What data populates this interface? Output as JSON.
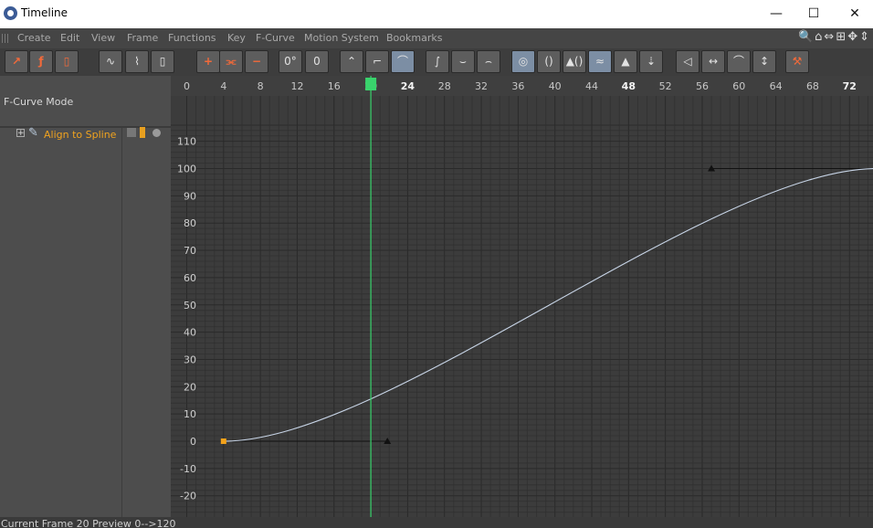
{
  "window": {
    "title": "Timeline"
  },
  "window_controls": {
    "minimize": "—",
    "maximize": "☐",
    "close": "✕"
  },
  "menu": [
    "Create",
    "Edit",
    "View",
    "Frame",
    "Functions",
    "Key",
    "F-Curve",
    "Motion System",
    "Bookmarks"
  ],
  "nav_icons": "🔍⌂⇔⊞✥⇕",
  "toolbar": {
    "buttons": [
      {
        "name": "dope-sheet-mode-button",
        "glyph": "↗",
        "accent": true
      },
      {
        "name": "fcurve-mode-button",
        "glyph": "ƒ",
        "accent": true
      },
      {
        "name": "motion-mode-button",
        "glyph": "▯",
        "accent": true
      },
      {
        "name": "zoom-curves-button",
        "glyph": "∿"
      },
      {
        "name": "frame-all-button",
        "glyph": "⌇"
      },
      {
        "name": "frame-selected-button",
        "glyph": "▯"
      },
      {
        "name": "add-key-button",
        "glyph": "+",
        "accent": true
      },
      {
        "name": "add-keys-button",
        "glyph": "⫘",
        "accent": true
      },
      {
        "name": "delete-key-button",
        "glyph": "−",
        "accent": true
      },
      {
        "name": "rotate-handles-button",
        "glyph": "0°"
      },
      {
        "name": "zero-length-button",
        "glyph": "0"
      },
      {
        "name": "interpolation-linear-button",
        "glyph": "⌃"
      },
      {
        "name": "interpolation-step-button",
        "glyph": "⌐"
      },
      {
        "name": "interpolation-spline-button",
        "glyph": "⌒",
        "selected": true
      },
      {
        "name": "ease-ease-button",
        "glyph": "∫"
      },
      {
        "name": "ease-in-button",
        "glyph": "⌣"
      },
      {
        "name": "ease-out-button",
        "glyph": "⌢"
      },
      {
        "name": "auto-tangents-button",
        "glyph": "◎",
        "selected": true
      },
      {
        "name": "clamp-button",
        "glyph": "()"
      },
      {
        "name": "clamp-zero-button",
        "glyph": "▲()"
      },
      {
        "name": "overshoot-button",
        "glyph": "≈",
        "selected": true
      },
      {
        "name": "weighted-tangent-button",
        "glyph": "▲"
      },
      {
        "name": "break-tangent-button",
        "glyph": "⇣"
      },
      {
        "name": "lock-tangent-angle-button",
        "glyph": "◁🔒"
      },
      {
        "name": "lock-tangent-length-button",
        "glyph": "↔🔒"
      },
      {
        "name": "lock-key-time-button",
        "glyph": "⌒🔒"
      },
      {
        "name": "lock-key-value-button",
        "glyph": "↕🔒"
      },
      {
        "name": "snap-tool-button",
        "glyph": "⚒",
        "accent": true
      }
    ]
  },
  "left_panel": {
    "mode_label": "F-Curve Mode",
    "track": {
      "expander": "+",
      "label": "Align to Spline"
    }
  },
  "ruler": {
    "frames": [
      "0",
      "4",
      "8",
      "12",
      "16",
      "20",
      "24",
      "28",
      "32",
      "36",
      "40",
      "44",
      "48",
      "52",
      "56",
      "60",
      "64",
      "68",
      "72"
    ],
    "bold_frames": [
      "24",
      "48",
      "72"
    ]
  },
  "value_axis": {
    "labels": [
      "110",
      "100",
      "90",
      "80",
      "70",
      "60",
      "50",
      "40",
      "30",
      "20",
      "10",
      "0",
      "-10",
      "-20"
    ]
  },
  "current_frame": "20",
  "curve": {
    "color": "#c7d4e6",
    "keys": [
      {
        "frame": 4,
        "value": 0,
        "tangent_right_frame": 21.8
      },
      {
        "frame": 75,
        "value": 100,
        "tangent_left_frame": 57
      }
    ]
  },
  "colors": {
    "playhead": "#39d36c",
    "key": "#f3a21a",
    "accent_label": "#f0a31f",
    "grid": "#2f2f2f",
    "background": "#3c3c3c"
  },
  "status": {
    "text": "Current Frame  20  Preview  0-->120"
  }
}
